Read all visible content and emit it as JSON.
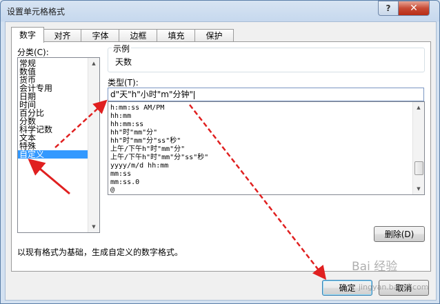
{
  "window": {
    "title": "设置单元格格式",
    "help_label": "?",
    "close_label": "✕"
  },
  "tabs": [
    {
      "label": "数字",
      "active": true
    },
    {
      "label": "对齐",
      "active": false
    },
    {
      "label": "字体",
      "active": false
    },
    {
      "label": "边框",
      "active": false
    },
    {
      "label": "填充",
      "active": false
    },
    {
      "label": "保护",
      "active": false
    }
  ],
  "category": {
    "label": "分类(C):",
    "items": [
      "常规",
      "数值",
      "货币",
      "会计专用",
      "日期",
      "时间",
      "百分比",
      "分数",
      "科学记数",
      "文本",
      "特殊",
      "自定义"
    ],
    "selected": "自定义"
  },
  "sample": {
    "label": "示例",
    "value": "天数"
  },
  "type": {
    "label": "类型(T):",
    "value": "d\"天\"h\"小时\"m\"分钟\""
  },
  "formats": [
    "h:mm:ss AM/PM",
    "hh:mm",
    "hh:mm:ss",
    "hh\"时\"mm\"分\"",
    "hh\"时\"mm\"分\"ss\"秒\"",
    "上午/下午h\"时\"mm\"分\"",
    "上午/下午h\"时\"mm\"分\"ss\"秒\"",
    "yyyy/m/d hh:mm",
    "mm:ss",
    "mm:ss.0",
    "@"
  ],
  "buttons": {
    "delete": "删除(D)",
    "ok": "确定",
    "cancel": "取消"
  },
  "description": "以现有格式为基础，生成自定义的数字格式。",
  "watermark": {
    "brand": "Bai 经验",
    "url": "jingyan.baidu.com"
  },
  "colors": {
    "selection": "#3399ff",
    "annotation_arrow": "#e02020",
    "close_button": "#c74b35"
  }
}
